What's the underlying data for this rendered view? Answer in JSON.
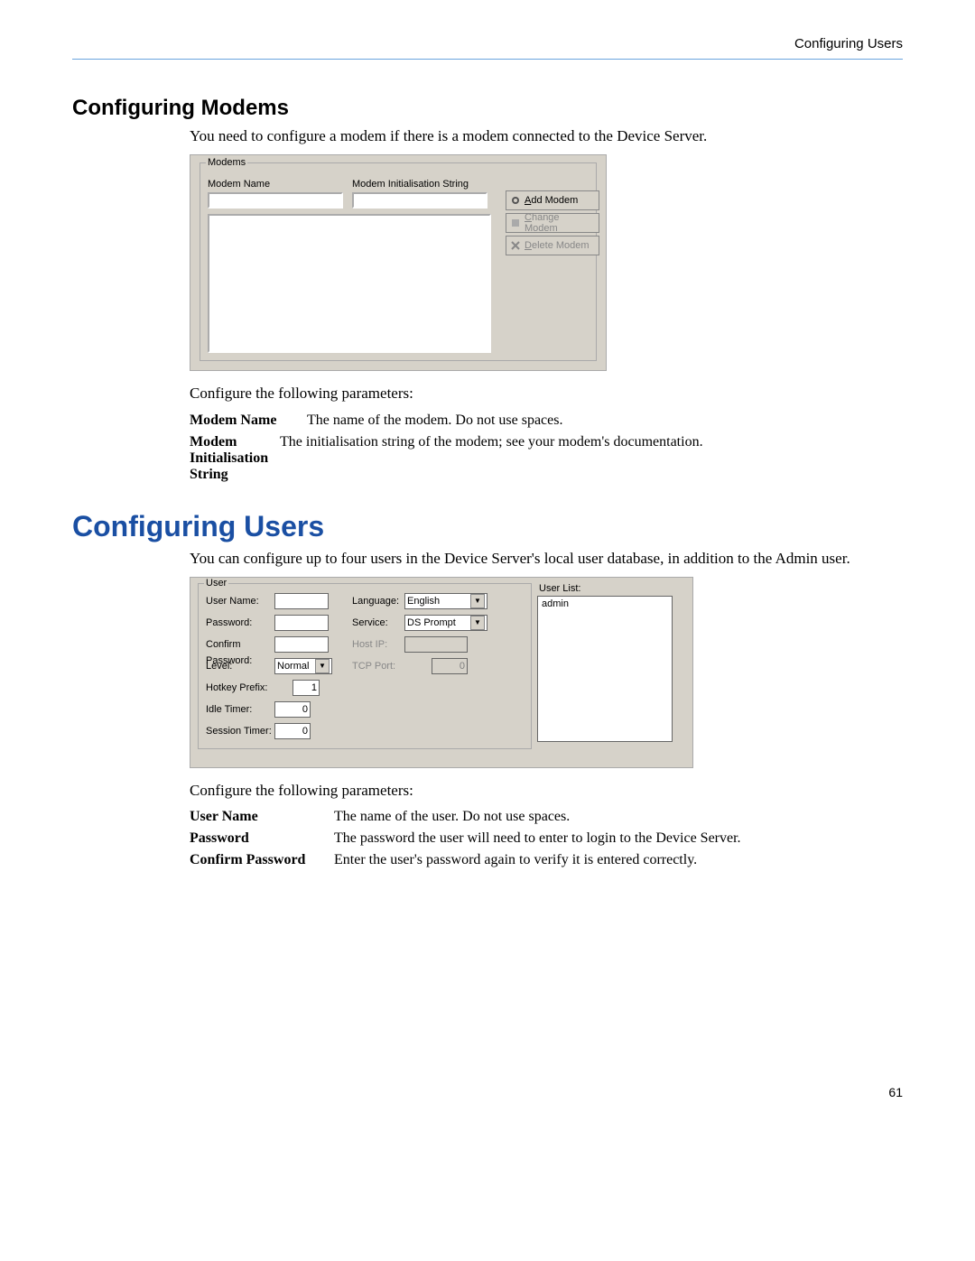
{
  "header": {
    "right": "Configuring Users"
  },
  "sections": {
    "modems_heading": "Configuring Modems",
    "modems_intro": "You need to configure a modem if there is a modem connected to the Device Server.",
    "modems_ui": {
      "legend": "Modems",
      "col1_label": "Modem Name",
      "col2_label": "Modem Initialisation String",
      "btn_add": "Add Modem",
      "btn_change": "Change Modem",
      "btn_delete": "Delete Modem"
    },
    "modems_params_intro": "Configure the following parameters:",
    "modems_params": {
      "name_label": "Modem Name",
      "name_desc": "The name of the modem. Do not use spaces.",
      "init_label": "Modem Initialisation String",
      "init_desc": "The initialisation string of the modem; see your modem's documentation."
    },
    "users_heading": "Configuring Users",
    "users_intro": "You can configure up to four users in the Device Server's local user database, in addition to the Admin user.",
    "users_ui": {
      "legend": "User",
      "labels": {
        "user_name": "User Name:",
        "password": "Password:",
        "confirm": "Confirm Password:",
        "level": "Level:",
        "hotkey": "Hotkey Prefix:",
        "idle": "Idle Timer:",
        "session": "Session Timer:",
        "language": "Language:",
        "service": "Service:",
        "hostip": "Host IP:",
        "tcpport": "TCP Port:"
      },
      "values": {
        "level": "Normal",
        "hotkey": "1",
        "idle": "0",
        "session": "0",
        "language": "English",
        "service": "DS Prompt",
        "tcpport": "0"
      },
      "userlist_label": "User List:",
      "userlist_items": "admin"
    },
    "users_params_intro": "Configure the following parameters:",
    "users_params": {
      "uname_label": "User Name",
      "uname_desc": "The name of the user. Do not use spaces.",
      "pwd_label": "Password",
      "pwd_desc": "The password the user will need to enter to login to the Device Server.",
      "cpwd_label": "Confirm Password",
      "cpwd_desc": "Enter the user's password again to verify it is entered correctly."
    }
  },
  "footer": {
    "page": "61"
  }
}
